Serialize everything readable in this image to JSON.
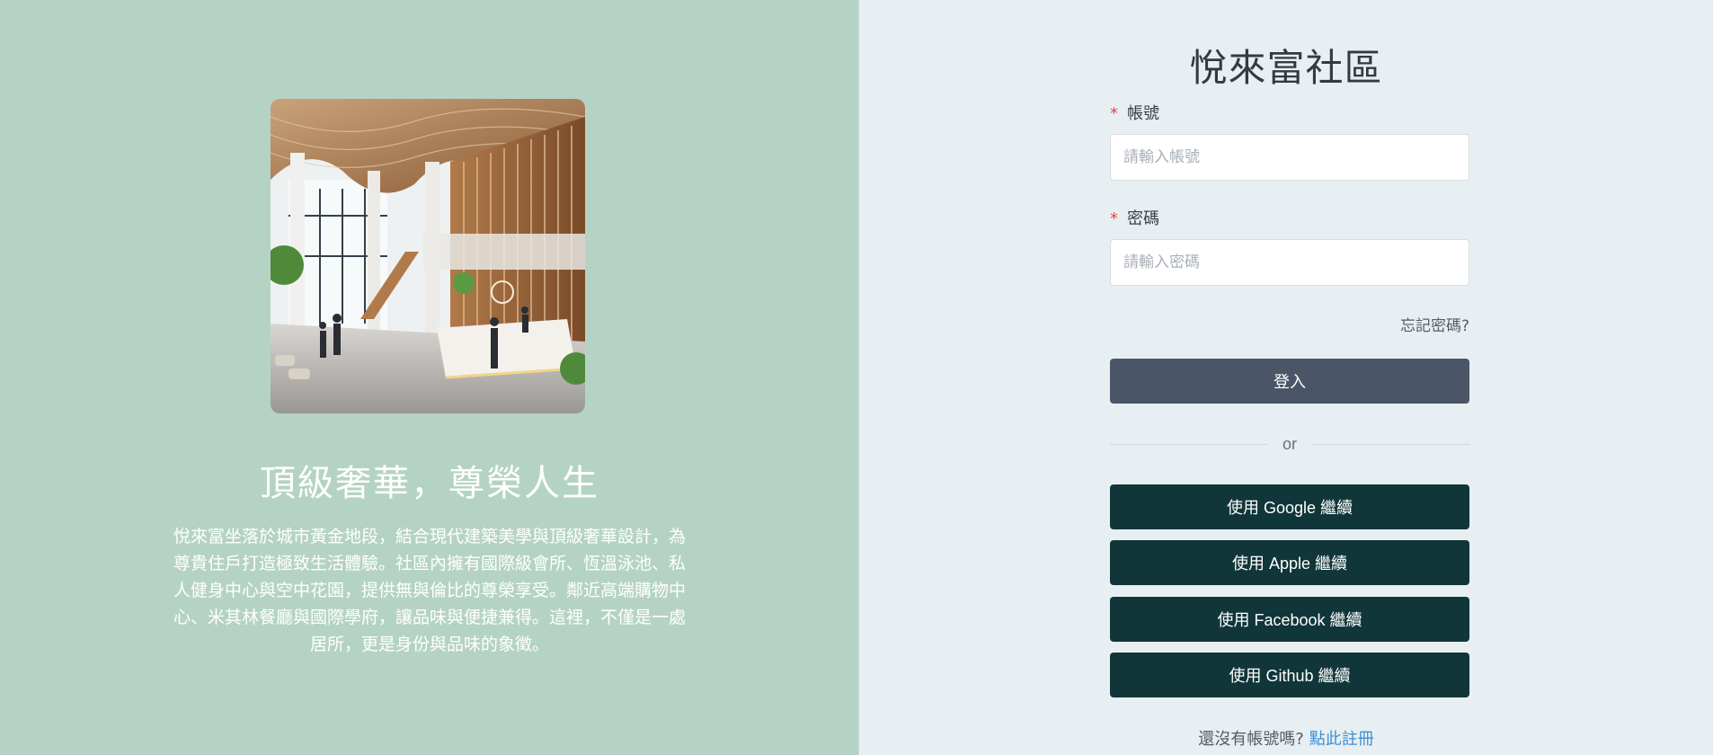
{
  "left": {
    "tagline": "頂級奢華，尊榮人生",
    "description": "悅來富坐落於城市黃金地段，結合現代建築美學與頂級奢華設計，為尊貴住戶打造極致生活體驗。社區內擁有國際級會所、恆溫泳池、私人健身中心與空中花園，提供無與倫比的尊榮享受。鄰近高端購物中心、米其林餐廳與國際學府，讓品味與便捷兼得。這裡，不僅是一處居所，更是身份與品味的象徵。"
  },
  "login": {
    "title": "悅來富社區",
    "account_label": "帳號",
    "account_placeholder": "請輸入帳號",
    "account_value": "",
    "password_label": "密碼",
    "password_placeholder": "請輸入密碼",
    "password_value": "",
    "required_mark": "*",
    "forgot_label": "忘記密碼?",
    "submit_label": "登入",
    "divider_label": "or",
    "social": {
      "google": "使用 Google 繼續",
      "apple": "使用 Apple 繼續",
      "facebook": "使用 Facebook 繼續",
      "github": "使用 Github 繼續"
    },
    "signup_prompt": "還沒有帳號嗎?",
    "signup_link": "點此註冊"
  },
  "colors": {
    "left_bg": "#b5d3c4",
    "right_bg": "#e8eff2",
    "primary_button": "#4a5568",
    "social_button": "#11363a",
    "link": "#3d8fd9",
    "required": "#e04848"
  },
  "icons": {
    "hero_image": "luxury-lobby-illustration"
  }
}
